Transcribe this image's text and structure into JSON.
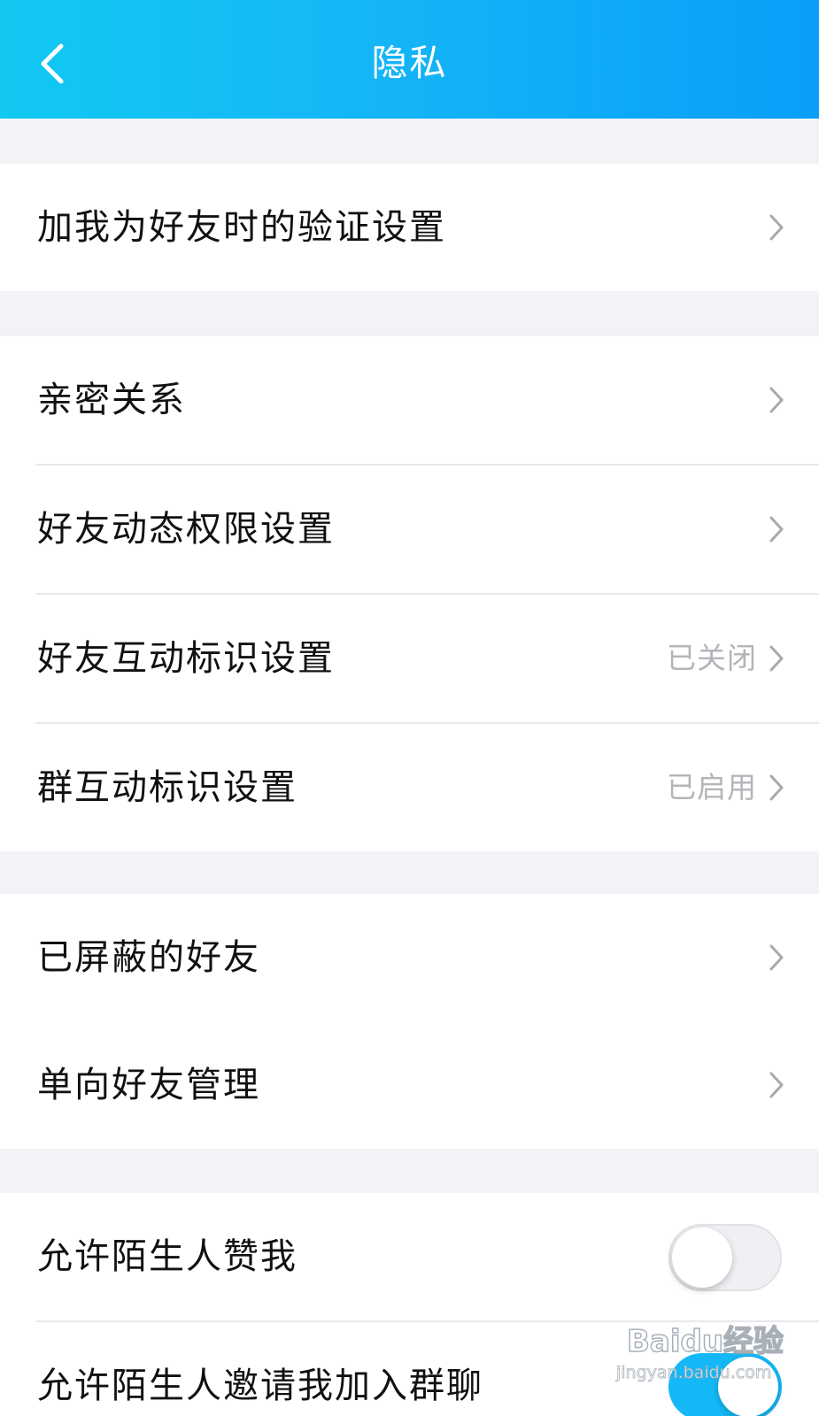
{
  "header": {
    "title": "隐私",
    "back_icon": "chevron-left-icon"
  },
  "groups": [
    {
      "items": [
        {
          "label": "加我为好友时的验证设置",
          "value": "",
          "control": "chevron"
        }
      ]
    },
    {
      "items": [
        {
          "label": "亲密关系",
          "value": "",
          "control": "chevron"
        },
        {
          "label": "好友动态权限设置",
          "value": "",
          "control": "chevron"
        },
        {
          "label": "好友互动标识设置",
          "value": "已关闭",
          "control": "chevron"
        },
        {
          "label": "群互动标识设置",
          "value": "已启用",
          "control": "chevron"
        }
      ]
    },
    {
      "items": [
        {
          "label": "已屏蔽的好友",
          "value": "",
          "control": "chevron"
        },
        {
          "label": "单向好友管理",
          "value": "",
          "control": "chevron"
        }
      ]
    },
    {
      "items": [
        {
          "label": "允许陌生人赞我",
          "control": "toggle",
          "on": false
        },
        {
          "label": "允许陌生人邀请我加入群聊",
          "control": "toggle",
          "on": true
        }
      ]
    }
  ],
  "watermark": {
    "logo": "Baidu经验",
    "sub": "jingyan.baidu.com"
  },
  "colors": {
    "header_gradient_start": "#12c9f3",
    "header_gradient_end": "#0a9ef9",
    "background": "#f2f3f7",
    "toggle_on": "#14b8f7",
    "secondary_text": "#b4b4ba"
  }
}
